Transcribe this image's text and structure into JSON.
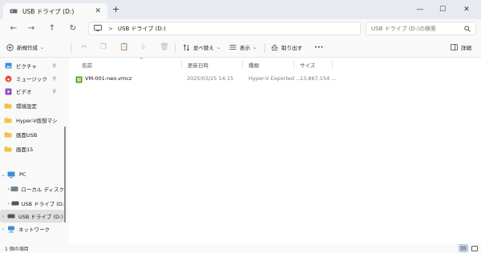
{
  "window": {
    "tab_title": "USB ドライブ (D:)",
    "tab_close_glyph": "✕",
    "new_tab_glyph": "+",
    "minimize_glyph": "—",
    "maximize_glyph": "☐",
    "close_glyph": "✕"
  },
  "nav_buttons": {
    "back_glyph": "←",
    "forward_glyph": "→",
    "up_glyph": "↑",
    "refresh_glyph": "↻"
  },
  "address": {
    "separator": ">",
    "path": "USB ドライブ (D:)"
  },
  "search": {
    "placeholder": "USB ドライブ (D:)の検索",
    "icon": "search-icon"
  },
  "toolbar": {
    "new_label": "新規作成",
    "sort_label": "並べ替え",
    "view_label": "表示",
    "eject_label": "取り出す",
    "more_label": "•••",
    "details_label": "詳細",
    "dropdown_glyph": "⌄"
  },
  "sidebar": {
    "quick_access": [
      {
        "label": "ピクチャ",
        "pinned": true,
        "icon": "pictures-icon"
      },
      {
        "label": "ミュージック",
        "pinned": true,
        "icon": "music-icon"
      },
      {
        "label": "ビデオ",
        "pinned": true,
        "icon": "videos-icon"
      },
      {
        "label": "環境設定",
        "icon": "folder-icon"
      },
      {
        "label": "Hyper-V仮想マシ",
        "icon": "folder-icon"
      },
      {
        "label": "画面USB",
        "icon": "folder-icon"
      },
      {
        "label": "画面15",
        "icon": "folder-icon"
      }
    ],
    "pin_glyph": "📌",
    "tree": [
      {
        "label": "PC",
        "expanded": true,
        "icon": "pc-icon"
      },
      {
        "label": "ローカル ディスク",
        "icon": "drive-icon"
      },
      {
        "label": "USB ドライブ (D:",
        "icon": "usb-drive-icon"
      },
      {
        "label": "USB ドライブ (D:)",
        "icon": "usb-drive-icon",
        "selected": true
      },
      {
        "label": "ネットワーク",
        "icon": "network-icon"
      }
    ]
  },
  "file_list": {
    "columns": [
      "名前",
      "更新日時",
      "種類",
      "サイズ"
    ],
    "sort_indicator": "^",
    "rows": [
      {
        "name": "VM-001-neo.vmcz",
        "modified": "2025/03/25 14:15",
        "type": "Hyper-V Exported ...",
        "size": "13,867,154 ..."
      }
    ]
  },
  "status_bar": {
    "item_count": "1 個の項目"
  },
  "colors": {
    "accent": "#0067c0",
    "folder_yellow": "#f2c14e",
    "selection": "#e0e0e0"
  }
}
